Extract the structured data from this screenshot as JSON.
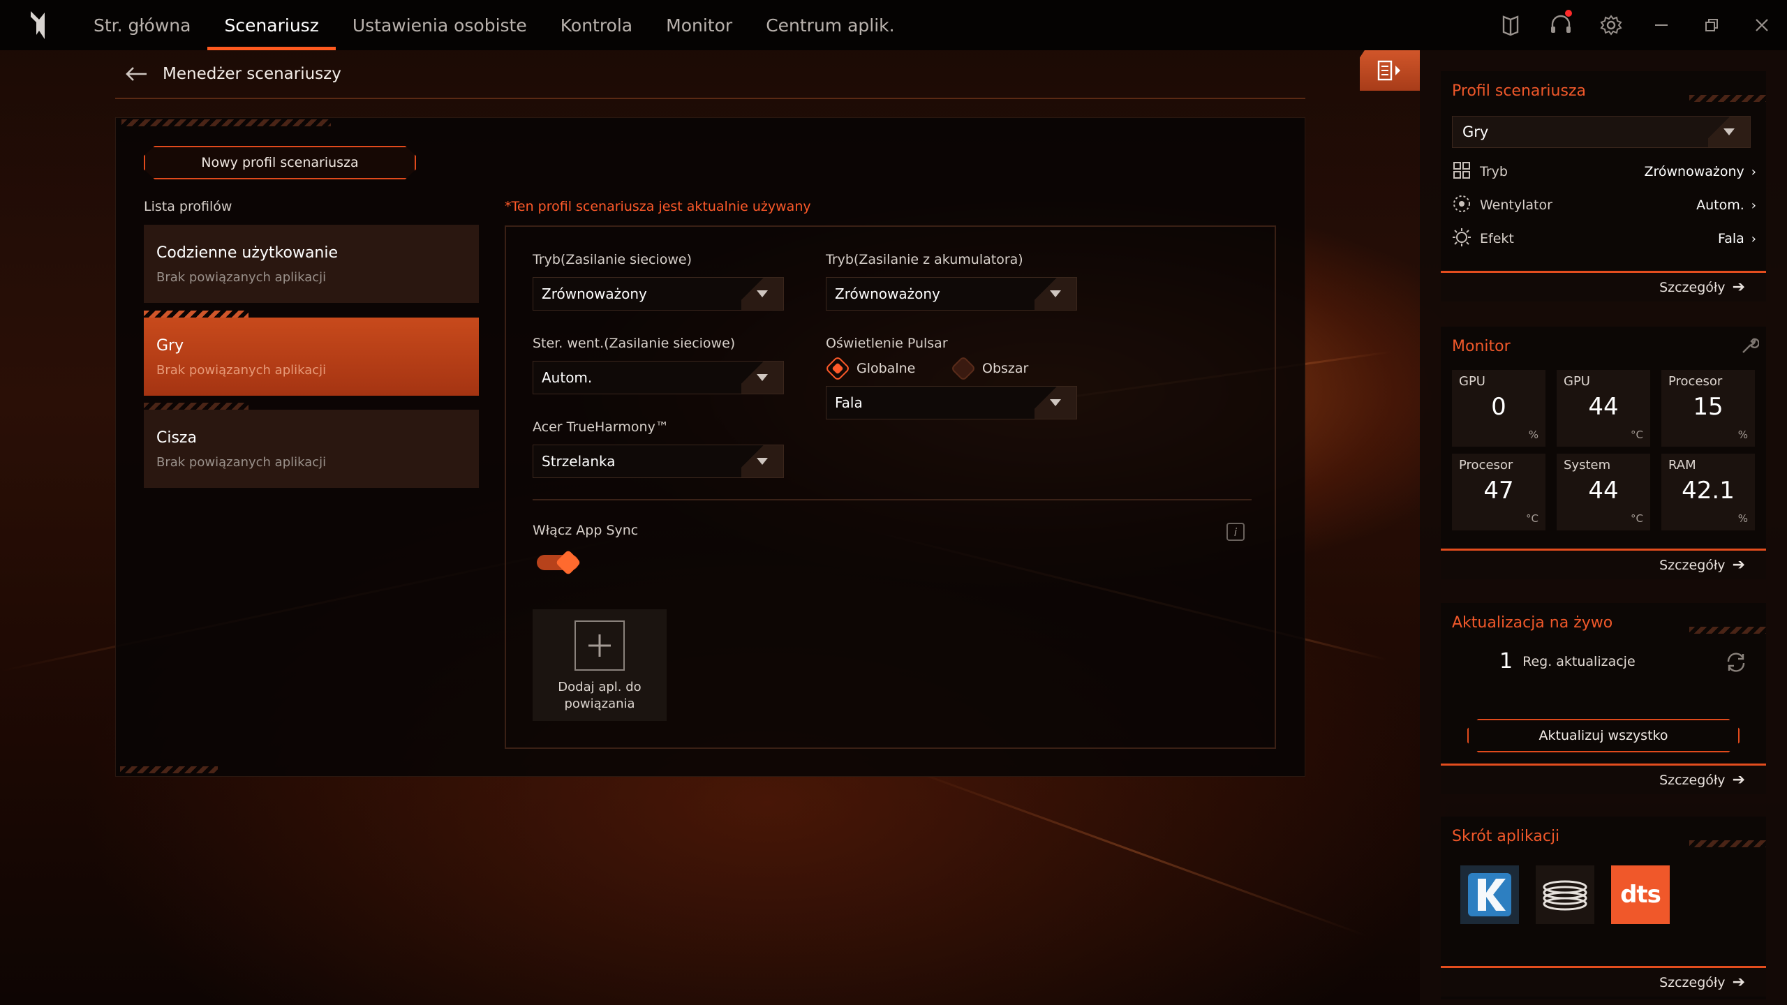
{
  "nav": {
    "items": [
      {
        "label": "Str. główna"
      },
      {
        "label": "Scenariusz"
      },
      {
        "label": "Ustawienia osobiste"
      },
      {
        "label": "Kontrola"
      },
      {
        "label": "Monitor"
      },
      {
        "label": "Centrum aplik."
      }
    ],
    "active_index": 1
  },
  "header": {
    "title": "Menedżer scenariuszy"
  },
  "main": {
    "new_profile_label": "Nowy profil scenariusza",
    "list_label": "Lista profilów",
    "profiles": [
      {
        "name": "Codzienne użytkowanie",
        "sub": "Brak powiązanych aplikacji"
      },
      {
        "name": "Gry",
        "sub": "Brak powiązanych aplikacji"
      },
      {
        "name": "Cisza",
        "sub": "Brak powiązanych aplikacji"
      }
    ],
    "active_profile_index": 1,
    "active_note": "*Ten profil scenariusza jest aktualnie używany",
    "settings": {
      "mode_ac_label": "Tryb(Zasilanie sieciowe)",
      "mode_ac_value": "Zrównoważony",
      "mode_battery_label": "Tryb(Zasilanie z akumulatora)",
      "mode_battery_value": "Zrównoważony",
      "fan_ac_label": "Ster. went.(Zasilanie sieciowe)",
      "fan_ac_value": "Autom.",
      "pulsar_label": "Oświetlenie Pulsar",
      "pulsar_global_label": "Globalne",
      "pulsar_area_label": "Obszar",
      "pulsar_selected": "Globalne",
      "pulsar_effect_value": "Fala",
      "trueharmony_label": "Acer TrueHarmony™",
      "trueharmony_value": "Strzelanka",
      "app_sync_label": "Włącz App Sync",
      "app_sync_on": true,
      "add_app_label": "Dodaj apl. do powiązania"
    }
  },
  "sidebar": {
    "profile": {
      "title": "Profil scenariusza",
      "selected": "Gry",
      "rows": [
        {
          "key": "Tryb",
          "value": "Zrównoważony",
          "icon": "grid-icon"
        },
        {
          "key": "Wentylator",
          "value": "Autom.",
          "icon": "fan-icon"
        },
        {
          "key": "Efekt",
          "value": "Fala",
          "icon": "sun-icon"
        }
      ],
      "details": "Szczegóły"
    },
    "monitor": {
      "title": "Monitor",
      "tiles": [
        {
          "label": "GPU",
          "value": "0",
          "unit": "%"
        },
        {
          "label": "GPU",
          "value": "44",
          "unit": "°C"
        },
        {
          "label": "Procesor",
          "value": "15",
          "unit": "%"
        },
        {
          "label": "Procesor",
          "value": "47",
          "unit": "°C"
        },
        {
          "label": "System",
          "value": "44",
          "unit": "°C"
        },
        {
          "label": "RAM",
          "value": "42.1",
          "unit": "%"
        }
      ],
      "details": "Szczegóły"
    },
    "live_update": {
      "title": "Aktualizacja na żywo",
      "count": "1",
      "count_label": "Reg. aktualizacje",
      "update_all": "Aktualizuj wszystko",
      "details": "Szczegóły"
    },
    "shortcuts": {
      "title": "Skrót aplikacji",
      "apps": [
        {
          "name": "killer-app-icon",
          "letter": "K"
        },
        {
          "name": "coil-app-icon",
          "letter": ""
        },
        {
          "name": "dts-app-icon",
          "letter": "dts"
        }
      ],
      "details": "Szczegóły"
    }
  },
  "colors": {
    "accent": "#ff5a1f",
    "accent_dark": "#a53412",
    "topbar_bg": "#050302"
  }
}
